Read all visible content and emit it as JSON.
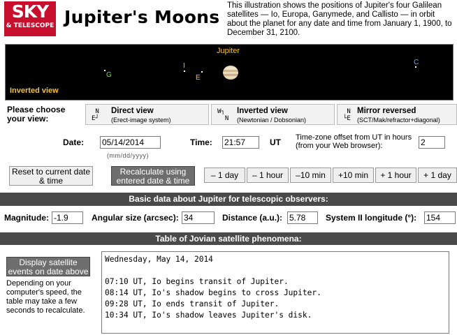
{
  "header": {
    "logo_line1": "SKY",
    "logo_line2": "& TELESCOPE",
    "title": "Jupiter's Moons",
    "intro": "This illustration shows the positions of Jupiter's four Galilean satellites — Io, Europa, Ganymede, and Callisto — in orbit about the planet for any date and time from January 1, 1900, to December 31, 2100."
  },
  "sky": {
    "planet_label": "Jupiter",
    "view_label": "Inverted view",
    "moons": [
      {
        "letter": "G",
        "color": "#7fdc3a"
      },
      {
        "letter": "I",
        "color": "#f5c23c"
      },
      {
        "letter": "E",
        "color": "#f5c23c"
      },
      {
        "letter": "C",
        "color": "#6fa0ff"
      }
    ]
  },
  "view": {
    "prompt": "Please choose your view:",
    "options": [
      {
        "name": "Direct view",
        "sub": "(Erect-image system)",
        "ori": " N\nE┘"
      },
      {
        "name": "Inverted view",
        "sub": "(Newtonian / Dobsonian)",
        "ori": "W┐\n  N"
      },
      {
        "name": "Mirror reversed",
        "sub": "(SCT/Mak/refractor+diagonal)",
        "ori": " N\n└E"
      }
    ]
  },
  "datetime": {
    "date_label": "Date:",
    "date_value": "05/14/2014",
    "date_hint": "(mm/dd/yyyy)",
    "time_label": "Time:",
    "time_value": "21:57",
    "ut_label": "UT",
    "tz_label": "Time-zone offset from UT in hours (from your Web browser):",
    "tz_value": "2"
  },
  "buttons": {
    "reset": "Reset to current date & time",
    "recalc": "Recalculate using entered date & time",
    "minus_day": "– 1 day",
    "minus_hour": "– 1 hour",
    "minus_10min": "–10 min",
    "plus_10min": "+10 min",
    "plus_hour": "+ 1 hour",
    "plus_day": "+ 1 day"
  },
  "basic": {
    "heading": "Basic data about Jupiter for telescopic observers:",
    "magnitude_label": "Magnitude:",
    "magnitude_value": "-1.9",
    "angular_label": "Angular size (arcsec):",
    "angular_value": "34",
    "distance_label": "Distance (a.u.):",
    "distance_value": "5.78",
    "longitude_label": "System II longitude (°):",
    "longitude_value": "154"
  },
  "phenomena": {
    "heading": "Table of Jovian satellite phenomena:",
    "button": "Display satellite events on date above",
    "note": "Depending on your computer's speed, the table may take a few seconds to recalculate.",
    "text": "Wednesday, May 14, 2014\n\n07:10 UT, Io begins transit of Jupiter.\n08:14 UT, Io's shadow begins to cross Jupiter.\n09:28 UT, Io ends transit of Jupiter.\n10:34 UT, Io's shadow leaves Jupiter's disk."
  }
}
